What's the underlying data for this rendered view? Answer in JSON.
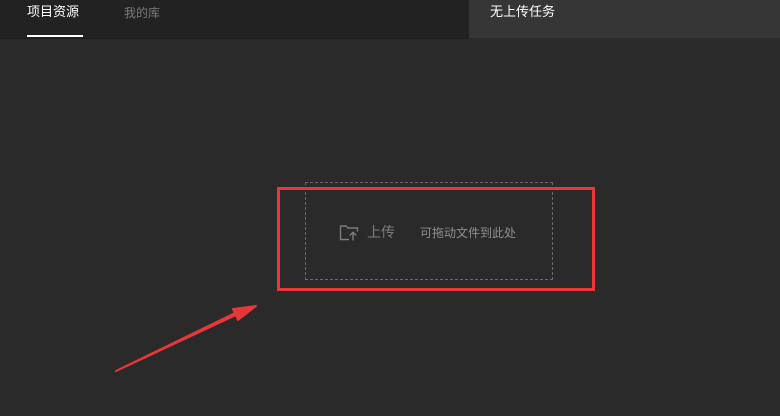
{
  "tabs": [
    {
      "label": "项目资源",
      "active": true
    },
    {
      "label": "我的库",
      "active": false
    }
  ],
  "upload_status": {
    "label": "无上传任务"
  },
  "dropzone": {
    "upload_label": "上传",
    "hint": "可拖动文件到此处",
    "icon": "folder-upload-icon"
  },
  "annotation": {
    "highlight_color": "#e8373b",
    "arrow_color": "#e8373b"
  },
  "colors": {
    "background": "#2a2a2a",
    "tabbar": "#222222",
    "status_panel": "#363636"
  }
}
